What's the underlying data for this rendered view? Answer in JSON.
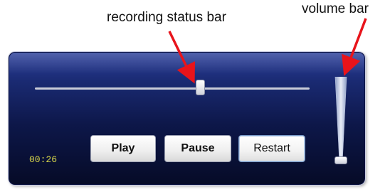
{
  "annotations": {
    "recording_status_label": "recording status bar",
    "volume_label": "volume bar",
    "arrow_color": "#e8141b"
  },
  "player": {
    "time": "00:26",
    "progress_fraction": 0.6,
    "volume_fraction": 0.0,
    "buttons": {
      "play": "Play",
      "pause": "Pause",
      "restart": "Restart"
    },
    "colors": {
      "panel_top": "#2b3f9a",
      "panel_bottom": "#060b27",
      "time_text": "#d9d84a"
    }
  }
}
